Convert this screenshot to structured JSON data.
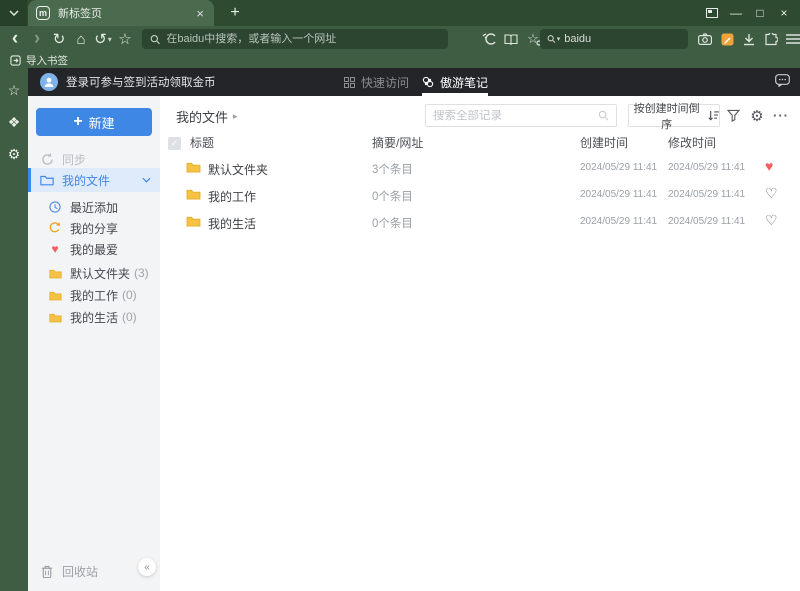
{
  "colors": {
    "titlebar_green": "#2e4a31",
    "toolbar_green": "#3f5d43",
    "addressbar_green": "#2c4531",
    "dark_header": "#232528",
    "accent_blue": "#3f87e5",
    "selected_item_bg": "#dfeafb",
    "folder_yellow": "#f6c243",
    "heart_red": "#f25c5c",
    "note_icon_orange": "#f0a33a"
  },
  "icons": {
    "back": "‹",
    "forward": "›",
    "refresh": "↻",
    "home": "⌂",
    "undo": "↺",
    "star": "☆",
    "menu_close": "×",
    "plus": "+",
    "minimize": "—",
    "maximize": "□",
    "close": "×",
    "caret_down": "▾",
    "gear": "⚙",
    "dots": "···",
    "heart_filled": "♥",
    "heart_outline": "♡",
    "collapse": "«",
    "breadcrumb_arrow": "▸",
    "check": "✓",
    "tab_logo_letter": "m",
    "notes_logo": "❖"
  },
  "browser": {
    "tab_title": "新标签页",
    "address_placeholder": "在baidu中搜索，或者输入一个网址",
    "search_engine_value": "baidu",
    "import_bookmarks": "导入书签"
  },
  "app": {
    "header": {
      "login_text": "登录可参与签到活动领取金币",
      "tab_quick_access": "快速访问",
      "tab_notes": "傲游笔记"
    },
    "sidebar": {
      "new_button": "新建",
      "sync_label": "同步",
      "my_files_label": "我的文件",
      "items": [
        {
          "label": "最近添加"
        },
        {
          "label": "我的分享"
        },
        {
          "label": "我的最爱"
        }
      ],
      "folders": [
        {
          "label": "默认文件夹",
          "count": "(3)"
        },
        {
          "label": "我的工作",
          "count": "(0)"
        },
        {
          "label": "我的生活",
          "count": "(0)"
        }
      ],
      "recycle_label": "回收站"
    },
    "main": {
      "breadcrumb": "我的文件",
      "search_placeholder": "搜索全部记录",
      "sort_label": "按创建时间倒序",
      "table": {
        "col_title": "标题",
        "col_summary": "摘要/网址",
        "col_created": "创建时间",
        "col_modified": "修改时间",
        "rows": [
          {
            "title": "默认文件夹",
            "summary": "3个条目",
            "created": "2024/05/29 11:41",
            "modified": "2024/05/29 11:41",
            "favorite": true
          },
          {
            "title": "我的工作",
            "summary": "0个条目",
            "created": "2024/05/29 11:41",
            "modified": "2024/05/29 11:41",
            "favorite": false
          },
          {
            "title": "我的生活",
            "summary": "0个条目",
            "created": "2024/05/29 11:41",
            "modified": "2024/05/29 11:41",
            "favorite": false
          }
        ]
      }
    }
  }
}
